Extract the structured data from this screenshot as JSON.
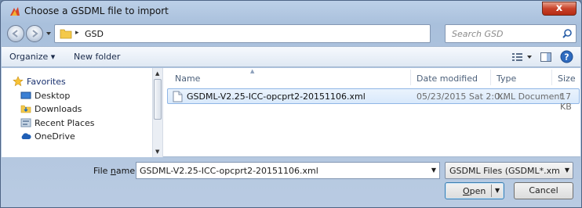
{
  "window": {
    "title": "Choose a GSDML file to import",
    "close_glyph": "x"
  },
  "address": {
    "crumb_sep": "▸",
    "folder": "GSD",
    "search_placeholder": "Search GSD"
  },
  "commands": {
    "organize": "Organize ▾",
    "new_folder": "New folder"
  },
  "nav": {
    "favorites": "Favorites",
    "items": [
      "Desktop",
      "Downloads",
      "Recent Places",
      "OneDrive"
    ]
  },
  "columns": {
    "name": "Name",
    "date": "Date modified",
    "type": "Type",
    "size": "Size"
  },
  "files": [
    {
      "name": "GSDML-V2.25-ICC-opcprt2-20151106.xml",
      "date": "05/23/2015 Sat 2:0...",
      "type": "XML Document",
      "size": "17 KB"
    }
  ],
  "footer": {
    "file_name_label_pre": "File ",
    "file_name_label_u": "n",
    "file_name_label_post": "ame:",
    "file_name_value": "GSDML-V2.25-ICC-opcprt2-20151106.xml",
    "filter": "GSDML Files (GSDML*.xml;GSD",
    "open": "Open",
    "cancel": "Cancel"
  },
  "colors": {
    "selection": "#d9e9fb",
    "selection_border": "#8fb6e6",
    "chrome": "#b9cbe2"
  }
}
